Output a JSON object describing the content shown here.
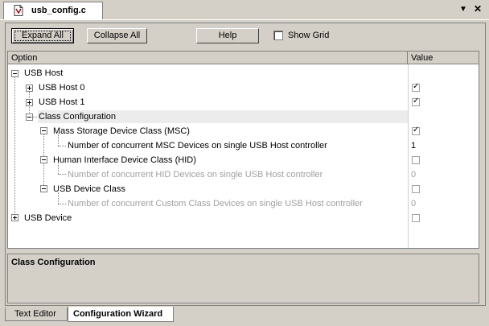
{
  "document_tab": {
    "title": "usb_config.c"
  },
  "toolbar": {
    "expand_all": "Expand All",
    "collapse_all": "Collapse All",
    "help": "Help",
    "show_grid": "Show Grid"
  },
  "columns": {
    "option": "Option",
    "value": "Value"
  },
  "tree": [
    {
      "label": "USB Host"
    },
    {
      "label": "USB Host 0",
      "value_checked": true
    },
    {
      "label": "USB Host 1",
      "value_checked": true
    },
    {
      "label": "Class Configuration"
    },
    {
      "label": "Mass Storage Device Class (MSC)",
      "value_checked": true
    },
    {
      "label": "Number of concurrent MSC Devices on single USB Host controller",
      "value": "1"
    },
    {
      "label": "Human Interface Device Class (HID)",
      "value_checked": false
    },
    {
      "label": "Number of concurrent HID Devices on single USB Host controller",
      "value": "0",
      "disabled": true
    },
    {
      "label": "USB Device Class",
      "value_checked": false
    },
    {
      "label": "Number of concurrent Custom Class Devices on single USB Host controller",
      "value": "0",
      "disabled": true
    },
    {
      "label": "USB Device",
      "value_checked": false
    }
  ],
  "description": {
    "title": "Class Configuration"
  },
  "bottom_tabs": {
    "text_editor": "Text Editor",
    "config_wizard": "Configuration Wizard"
  }
}
